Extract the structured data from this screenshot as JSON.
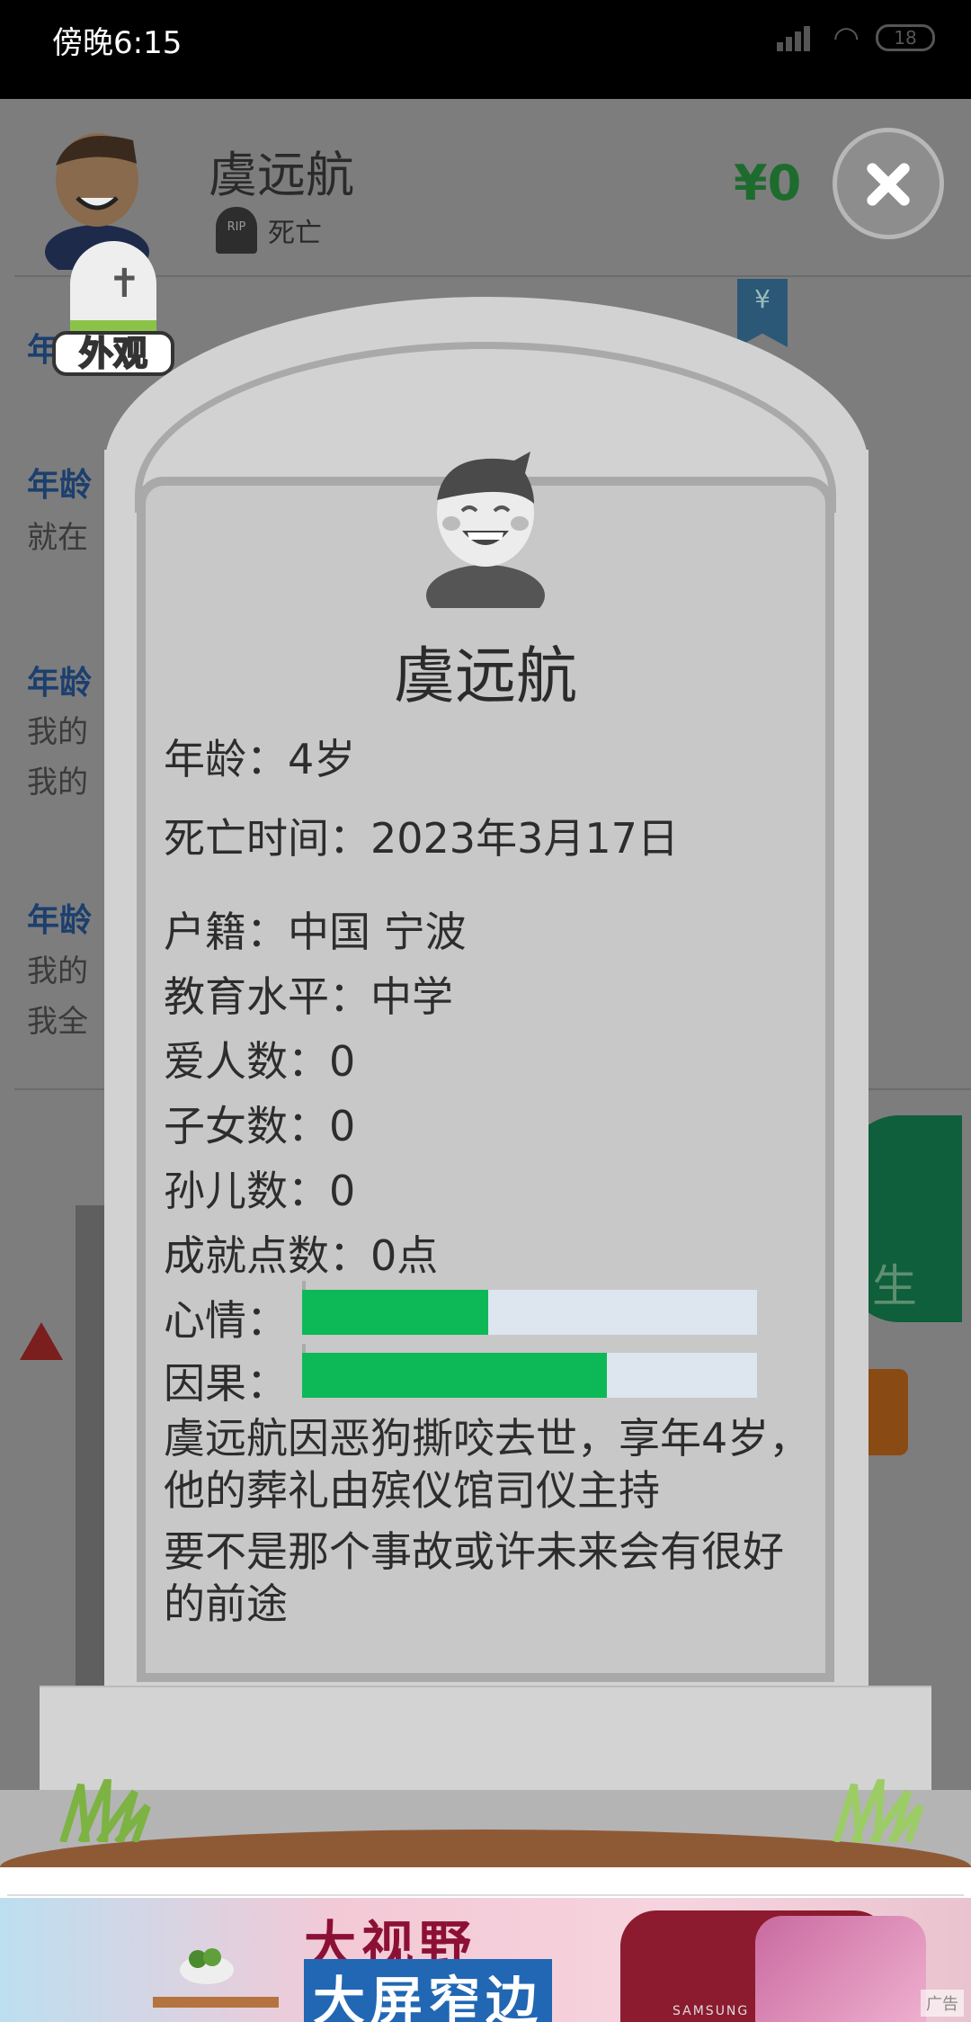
{
  "status_bar": {
    "time": "傍晚6:15",
    "battery": "18"
  },
  "background_screen": {
    "name": "虞远航",
    "status": "死亡",
    "rip_text": "RIP",
    "money": "¥0",
    "bookmark_symbol": "¥",
    "entries": [
      {
        "age": "年龄",
        "text": "就在"
      },
      {
        "age": "年龄",
        "text": "我的",
        "text2": "我的"
      },
      {
        "age": "年龄",
        "text": "我的",
        "text2": "我全"
      }
    ],
    "green_button_text": "生"
  },
  "appearance_button": {
    "label": "外观",
    "icon": "cross-icon"
  },
  "close_button": {
    "icon": "close-icon"
  },
  "tombstone": {
    "name": "虞远航",
    "age": "年龄：4岁",
    "death_date": "死亡时间：2023年3月17日",
    "hometown": "户籍：中国 宁波",
    "education": "教育水平：中学",
    "lovers": "爱人数：0",
    "children": "子女数：0",
    "grandchildren": "孙儿数：0",
    "achievements": "成就点数：0点",
    "mood_label": "心情：",
    "mood_level": 0.41,
    "karma_label": "因果：",
    "karma_level": 0.67,
    "bar_fill_color": "#0cb956",
    "bar_empty_color": "#dde5ef",
    "epitaph_1": "虞远航因恶狗撕咬去世，享年4岁，他的葬礼由殡仪馆司仪主持",
    "epitaph_2": "要不是那个事故或许未来会有很好的前途"
  },
  "ad_banner": {
    "line1": "大视野",
    "line2": "大屏窄边",
    "brand": "SAMSUNG",
    "tag": "广告"
  }
}
